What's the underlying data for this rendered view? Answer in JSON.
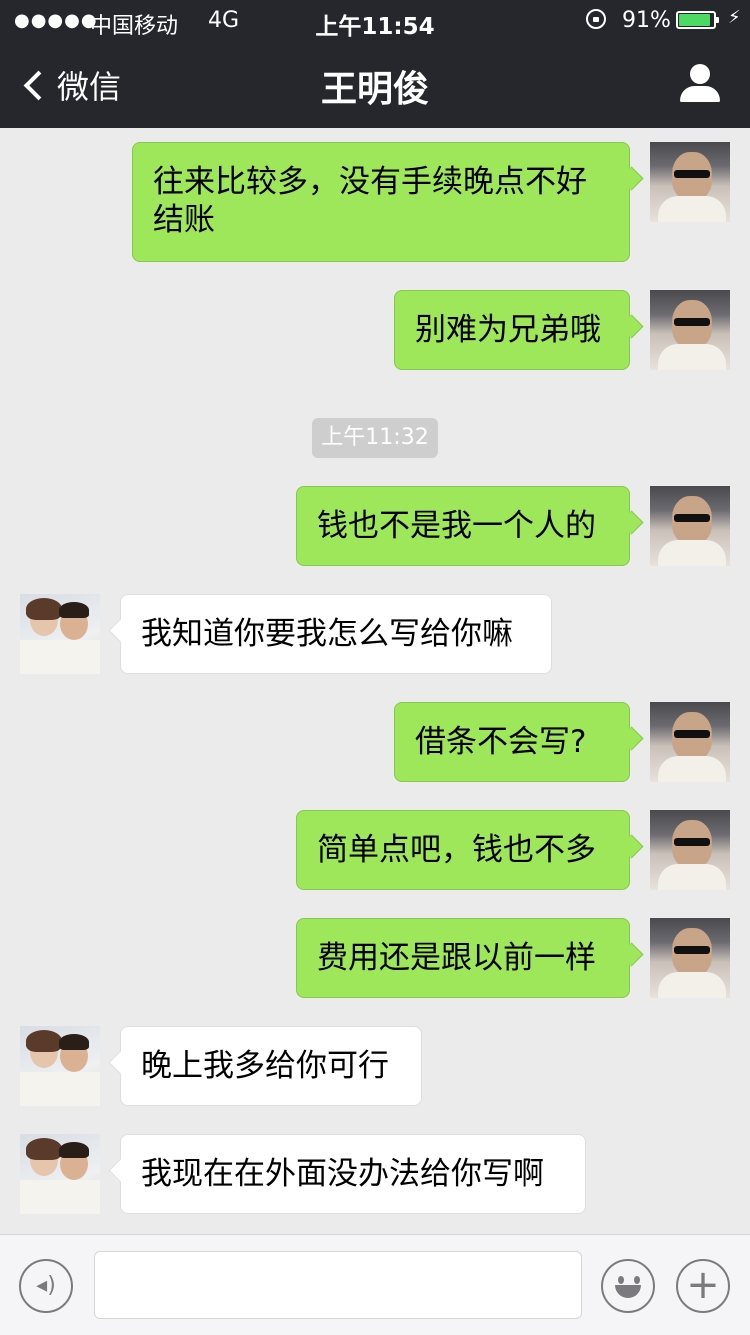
{
  "status_bar": {
    "signal": "●●●●●",
    "carrier": "中国移动",
    "network": "4G",
    "time": "上午11:54",
    "battery_percent": "91%",
    "battery_level": 0.91
  },
  "nav": {
    "back_label": "微信",
    "title": "王明俊"
  },
  "timestamp": "上午11:32",
  "messages": [
    {
      "from": "me",
      "text": "往来比较多，没有手续晚点不好结账"
    },
    {
      "from": "me",
      "text": "别难为兄弟哦"
    },
    {
      "from": "me",
      "text": "钱也不是我一个人的"
    },
    {
      "from": "them",
      "text": "我知道你要我怎么写给你嘛"
    },
    {
      "from": "me",
      "text": "借条不会写?"
    },
    {
      "from": "me",
      "text": "简单点吧，钱也不多"
    },
    {
      "from": "me",
      "text": "费用还是跟以前一样"
    },
    {
      "from": "them",
      "text": "晚上我多给你可行"
    },
    {
      "from": "them",
      "text": "我现在在外面没办法给你写啊"
    }
  ],
  "input": {
    "value": "",
    "placeholder": "",
    "plus_glyph": "+"
  },
  "colors": {
    "header_bg": "#25272c",
    "chat_bg": "#ebebeb",
    "my_bubble": "#9fe75a",
    "their_bubble": "#ffffff"
  }
}
